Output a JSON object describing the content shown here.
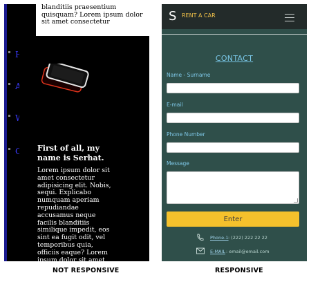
{
  "not_responsive": {
    "caption": "NOT RESPONSIVE",
    "top_text": "blanditiis praesentium quisquam? Lorem ipsum dolor sit amet consectetur",
    "nav_items": [
      "Ho",
      "Ab",
      "Wi",
      "Co"
    ],
    "heading": "First of all, my name is Serhat.",
    "body": "Lorem ipsum dolor sit amet consectetur adipisicing elit. Nobis, sequi. Explicabo numquam aperiam repudiandae accusamus neque facilis blanditiis similique impedit, eos sint ea fugit odit, vel temporibus quia, officiis eaque? Lorem ipsum dolor sit amet consectetur"
  },
  "responsive": {
    "caption": "RESPONSIVE",
    "brand_letter": "S",
    "brand_name": "RENT A CAR",
    "menu_icon": "hamburger-menu-icon",
    "contact_title": "CONTACT",
    "fields": {
      "name_label": "Name - Surname",
      "email_label": "E-mail",
      "phone_label": "Phone Number",
      "message_label": "Message"
    },
    "submit_label": "Enter",
    "phone": {
      "label": "Phone-1",
      "value": ": (222) 222 22 22",
      "icon": "phone-icon"
    },
    "email": {
      "label": "E-MAIL",
      "value": ": email@email.com",
      "icon": "envelope-icon"
    },
    "colors": {
      "panel_bg": "#2f4f4a",
      "header_bg": "#232b2a",
      "accent_blue": "#79c6e6",
      "button_yellow": "#f5c12c",
      "brand_yellow": "#f2c24a"
    }
  }
}
